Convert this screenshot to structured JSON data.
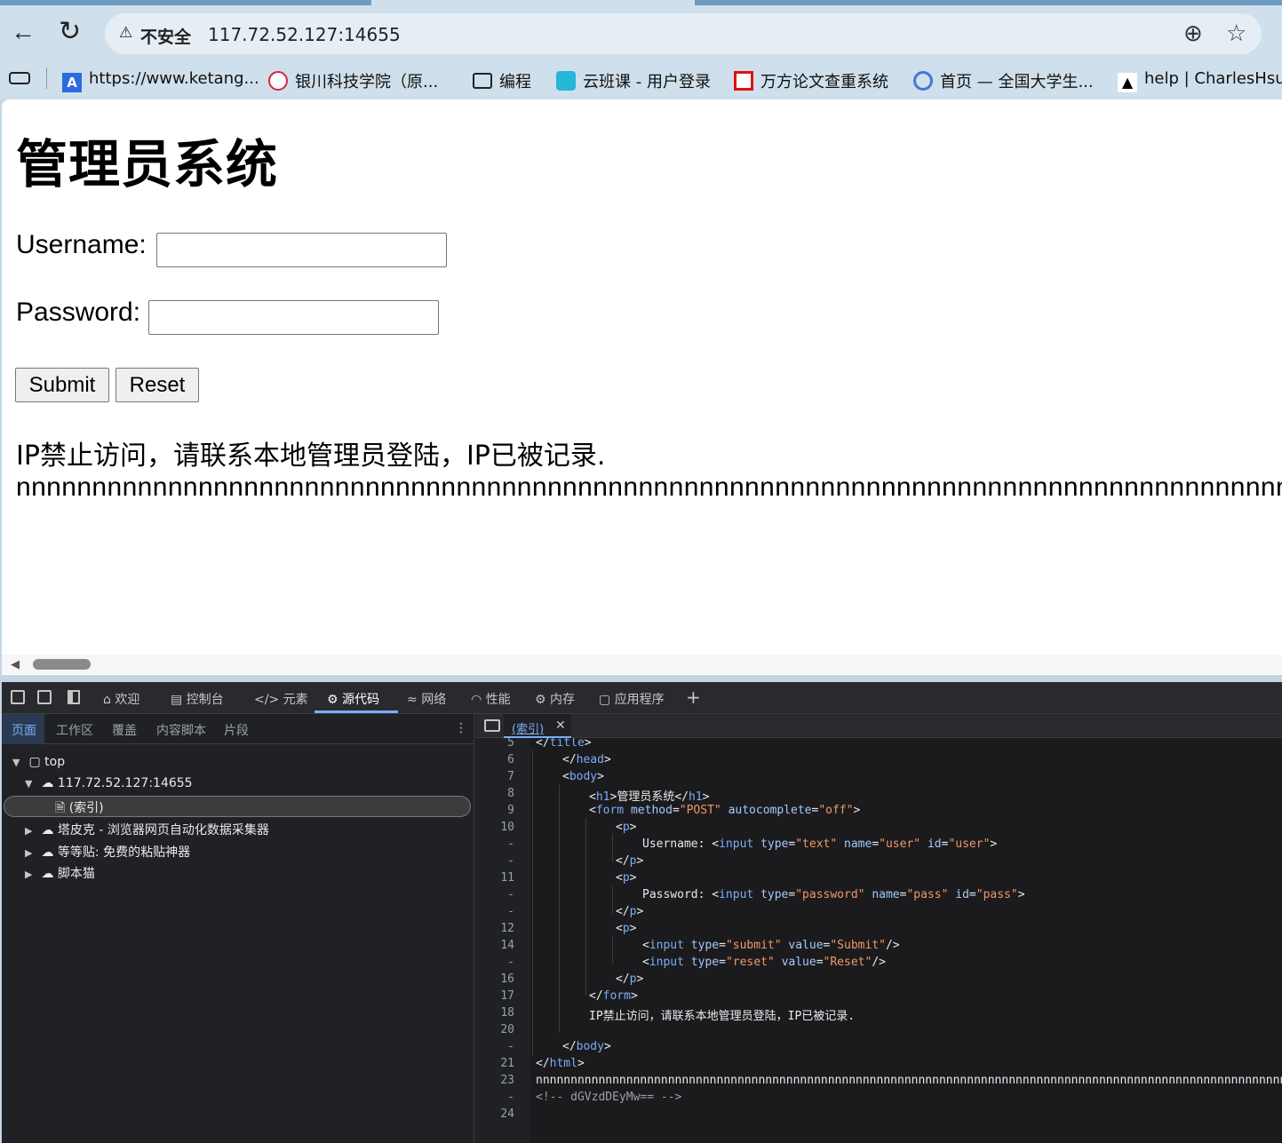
{
  "browser": {
    "security_icon": "⚠",
    "security_label": "不安全",
    "url": "117.72.52.127:14655",
    "back_icon": "←",
    "reload_icon": "↻",
    "zoom_icon": "⊕",
    "star_icon": "☆"
  },
  "bookmarks": [
    {
      "label": "https://www.ketang...",
      "icon": "ketang-icon"
    },
    {
      "label": "银川科技学院（原...",
      "icon": "school-icon"
    },
    {
      "label": "编程",
      "icon": "folder-icon"
    },
    {
      "label": "云班课 - 用户登录",
      "icon": "cloud-icon"
    },
    {
      "label": "万方论文查重系统",
      "icon": "wanfang-icon"
    },
    {
      "label": "首页 — 全国大学生...",
      "icon": "edu-icon"
    },
    {
      "label": "help | CharlesHsu's...",
      "icon": "bird-icon"
    }
  ],
  "page": {
    "title": "管理员系统",
    "username_label": "Username:",
    "password_label": "Password:",
    "username_value": "",
    "password_value": "",
    "submit_label": "Submit",
    "reset_label": "Reset",
    "message": "IP禁止访问，请联系本地管理员登陆，IP已被记录.",
    "filler": "nnnnnnnnnnnnnnnnnnnnnnnnnnnnnnnnnnnnnnnnnnnnnnnnnnnnnnnnnnnnnnnnnnnnnnnnnnnnnnnnnnnnnnnnnnnnnnnnnnn"
  },
  "devtools": {
    "tabs": [
      "欢迎",
      "控制台",
      "元素",
      "源代码",
      "网络",
      "性能",
      "内存",
      "应用程序"
    ],
    "active_tab": "源代码",
    "sub_tabs": [
      "页面",
      "工作区",
      "覆盖",
      "内容脚本",
      "片段"
    ],
    "tree": {
      "top": "top",
      "host": "117.72.52.127:14655",
      "index": "(索引)",
      "ext1": "塔皮克 - 浏览器网页自动化数据采集器",
      "ext2": "等等贴: 免费的粘贴神器",
      "ext3": "脚本猫"
    },
    "editor_tab": "(索引)",
    "line_numbers": [
      "5",
      "6",
      "7",
      "8",
      "9",
      "10",
      "-",
      "-",
      "11",
      "-",
      "-",
      "12",
      "14",
      "-",
      "16",
      "17",
      "18",
      "20",
      "-",
      "21",
      "23",
      "-",
      "24"
    ],
    "code": {
      "h1_text": "管理员系统",
      "username_text": "Username: ",
      "password_text": "Password: ",
      "message_text": "IP禁止访问，请联系本地管理员登陆，IP已被记录.",
      "filler_text": "nnnnnnnnnnnnnnnnnnnnnnnnnnnnnnnnnnnnnnnnnnnnnnnnnnnnnnnnnnnnnnnnnnnnnnnnnnnnnnnnnnnnnnnnnnnnnnnnnnnnnnnnnnnnnnnnnnnnnnnnnnnnnnnnnnnnnnn",
      "comment": "<!-- dGVzdDEyMw== -->"
    }
  }
}
